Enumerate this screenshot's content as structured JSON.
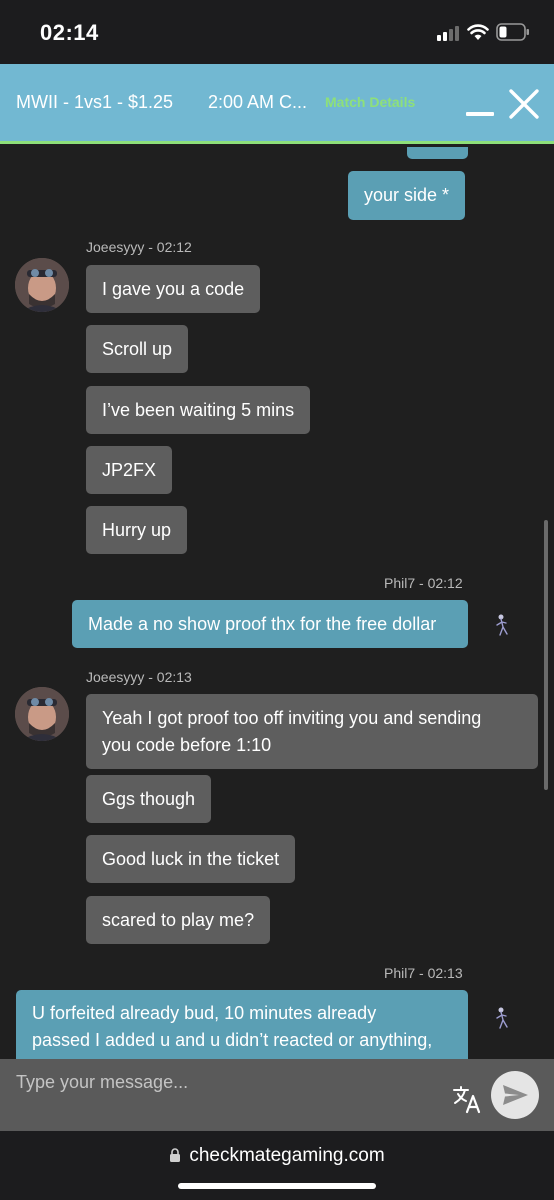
{
  "status_bar": {
    "time": "02:14"
  },
  "header": {
    "match_title": "MWII - 1vs1 - $1.25",
    "match_time": "2:00 AM C...",
    "match_details": "Match Details"
  },
  "messages": {
    "out_top": {
      "text": "your side *"
    },
    "group1": {
      "meta": "Joeesyyy - 02:12",
      "bubbles": [
        "I gave you a code",
        "Scroll up",
        "I’ve been waiting 5 mins",
        "JP2FX",
        "Hurry up"
      ]
    },
    "out1": {
      "meta": "Phil7  - 02:12",
      "text": "Made a no show proof thx for the free dollar"
    },
    "group2": {
      "meta": "Joeesyyy - 02:13",
      "bubble_multi_line1": "Yeah I got proof too off inviting you and sending",
      "bubble_multi_line2": "you code before 1:10",
      "bubbles": [
        "Ggs though",
        "Good luck in the ticket",
        "scared to play me?"
      ]
    },
    "out2": {
      "meta": "Phil7  - 02:13",
      "line1": "U forfeited already bud, 10 minutes already",
      "line2": "passed I added u and u didn’t reacted or anything,"
    }
  },
  "input": {
    "placeholder": "Type your message..."
  },
  "browser": {
    "url": "checkmategaming.com"
  },
  "colors": {
    "header": "#72b8d2",
    "accent_green": "#8ee07a",
    "incoming_bubble": "#5e5e5e",
    "outgoing_bubble": "#5b9fb4",
    "background": "#1f1f1f"
  },
  "icons": [
    "signal-icon",
    "wifi-icon",
    "battery-icon",
    "minimize-icon",
    "close-icon",
    "translate-icon",
    "send-icon",
    "lock-icon"
  ]
}
